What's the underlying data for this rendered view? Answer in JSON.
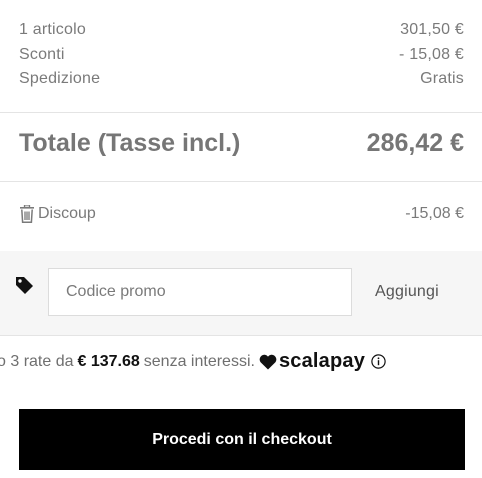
{
  "summary": {
    "rows": [
      {
        "label": "1 articolo",
        "value": "301,50 €"
      },
      {
        "label": "Sconti",
        "value": "- 15,08 €"
      },
      {
        "label": "Spedizione",
        "value": "Gratis"
      }
    ]
  },
  "total": {
    "label": "Totale (Tasse incl.)",
    "value": "286,42 €"
  },
  "applied_discount": {
    "code": "Discoup",
    "amount": "-15,08 €",
    "icon": "trash-icon"
  },
  "promo": {
    "placeholder": "Codice promo",
    "value": "",
    "apply_label": "Aggiungi",
    "icon": "tag-icon"
  },
  "scalapay": {
    "prefix": "o 3 rate da",
    "amount": "€ 137.68",
    "suffix": "senza interessi.",
    "brand": "scalapay"
  },
  "checkout": {
    "label": "Procedi con il checkout"
  }
}
